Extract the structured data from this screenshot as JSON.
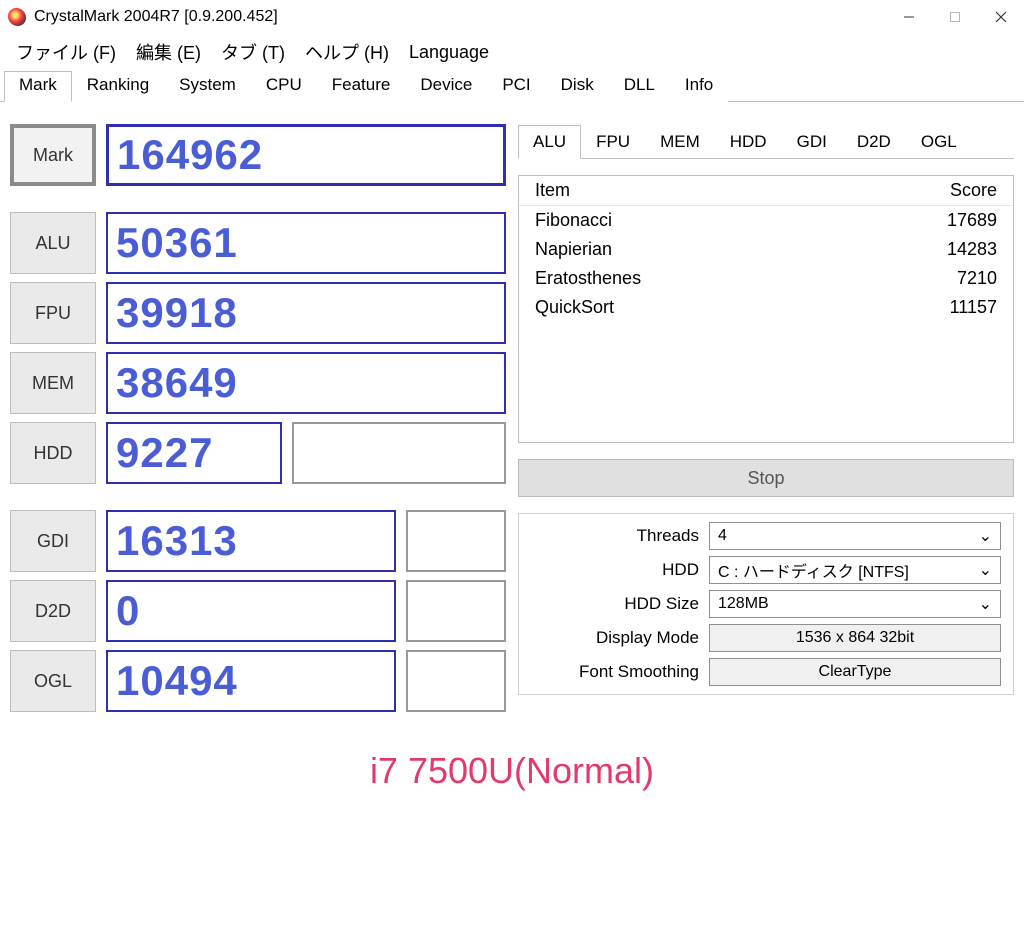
{
  "window": {
    "title": "CrystalMark 2004R7 [0.9.200.452]"
  },
  "menu": {
    "items": [
      "ファイル (F)",
      "編集 (E)",
      "タブ (T)",
      "ヘルプ (H)",
      "Language"
    ]
  },
  "main_tabs": {
    "items": [
      "Mark",
      "Ranking",
      "System",
      "CPU",
      "Feature",
      "Device",
      "PCI",
      "Disk",
      "DLL",
      "Info"
    ],
    "active_index": 0
  },
  "scores": {
    "mark": {
      "label": "Mark",
      "value": "164962"
    },
    "rows": [
      {
        "label": "ALU",
        "value": "50361"
      },
      {
        "label": "FPU",
        "value": "39918"
      },
      {
        "label": "MEM",
        "value": "38649"
      },
      {
        "label": "HDD",
        "value": "9227",
        "extra": true
      }
    ],
    "rows2": [
      {
        "label": "GDI",
        "value": "16313",
        "extra": true
      },
      {
        "label": "D2D",
        "value": "0",
        "extra": true
      },
      {
        "label": "OGL",
        "value": "10494",
        "extra": true
      }
    ]
  },
  "detail_tabs": {
    "items": [
      "ALU",
      "FPU",
      "MEM",
      "HDD",
      "GDI",
      "D2D",
      "OGL"
    ],
    "active_index": 0
  },
  "detail_table": {
    "head": {
      "item": "Item",
      "score": "Score"
    },
    "rows": [
      {
        "item": "Fibonacci",
        "score": "17689"
      },
      {
        "item": "Napierian",
        "score": "14283"
      },
      {
        "item": "Eratosthenes",
        "score": "7210"
      },
      {
        "item": "QuickSort",
        "score": "11157"
      }
    ]
  },
  "buttons": {
    "stop": "Stop"
  },
  "settings": {
    "threads": {
      "label": "Threads",
      "value": "4"
    },
    "hdd": {
      "label": "HDD",
      "value": "C : ハードディスク [NTFS]"
    },
    "hdd_size": {
      "label": "HDD Size",
      "value": "128MB"
    },
    "display_mode": {
      "label": "Display Mode",
      "value": "1536 x 864 32bit"
    },
    "font_smoothing": {
      "label": "Font Smoothing",
      "value": "ClearType"
    }
  },
  "footer": "i7 7500U(Normal)"
}
